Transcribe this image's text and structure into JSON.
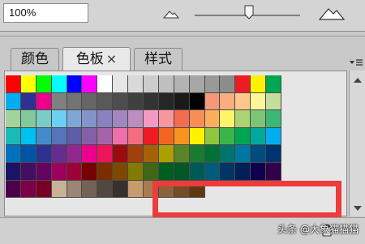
{
  "toolbar": {
    "zoom_value": "100%",
    "zoom_slider_level": 0.53
  },
  "tabs": [
    {
      "label": "颜色",
      "active": false
    },
    {
      "label": "色板",
      "active": true,
      "close": "×"
    },
    {
      "label": "样式",
      "active": false
    }
  ],
  "swatches": [
    [
      "#ff0000",
      "#ffff00",
      "#00ff00",
      "#00ffff",
      "#0000ff",
      "#ff00ff",
      "#ffffff",
      "#e6e6e6",
      "#d9d9d9",
      "#cccccc",
      "#bfbfbf",
      "#b3b3b3",
      "#a6a6a6",
      "#999999",
      "#8c8c8c",
      "#ed1c24",
      "#fff200",
      "#00a651"
    ],
    [
      "#00aeef",
      "#2e3192",
      "#ec008c",
      "#808080",
      "#737373",
      "#666666",
      "#595959",
      "#4d4d4d",
      "#404040",
      "#333333",
      "#262626",
      "#1a1a1a",
      "#000000",
      "#f7977a",
      "#f9ad81",
      "#fdc68a",
      "#fff79a",
      "#c4df9b"
    ],
    [
      "#a3d39c",
      "#82ca9d",
      "#7accc8",
      "#6dcff6",
      "#7ea7d8",
      "#8493ca",
      "#8882be",
      "#a187be",
      "#bc8dbf",
      "#f49ac2",
      "#f6989d",
      "#f26c4f",
      "#f68e55",
      "#fbaf5c",
      "#fff467",
      "#acd372",
      "#7cc576",
      "#3bb878"
    ],
    [
      "#1abbb4",
      "#00bff3",
      "#438ccb",
      "#5574b9",
      "#605ca8",
      "#8560a8",
      "#a763a8",
      "#f06ea9",
      "#f26d7d",
      "#ed1c24",
      "#f26522",
      "#f7941d",
      "#fff200",
      "#8dc73f",
      "#39b54a",
      "#00a651",
      "#00a99d",
      "#00aeef"
    ],
    [
      "#0072bc",
      "#0054a6",
      "#2e3192",
      "#662d91",
      "#92278f",
      "#ec008c",
      "#ed145b",
      "#9e0b0f",
      "#a0410d",
      "#a36209",
      "#aba000",
      "#598527",
      "#197b30",
      "#007236",
      "#00746b",
      "#0076a3",
      "#004b80",
      "#003471"
    ],
    [
      "#1b1464",
      "#440e62",
      "#630460",
      "#9e005d",
      "#9e0039",
      "#790000",
      "#7b2e00",
      "#7d4900",
      "#827b00",
      "#406618",
      "#005e20",
      "#005826",
      "#005952",
      "#005b7f",
      "#003663",
      "#002157",
      "#0d004c",
      "#32004b"
    ],
    [
      "#4b0049",
      "#7b0046",
      "#7a0026",
      "#c7b299",
      "#998675",
      "#736357",
      "#534741",
      "#37302d",
      "#c69c6d",
      "#a67c52",
      "#8c6239",
      "#754c24",
      "#603913"
    ]
  ],
  "watermark": "头条 @大象猫猫猫"
}
